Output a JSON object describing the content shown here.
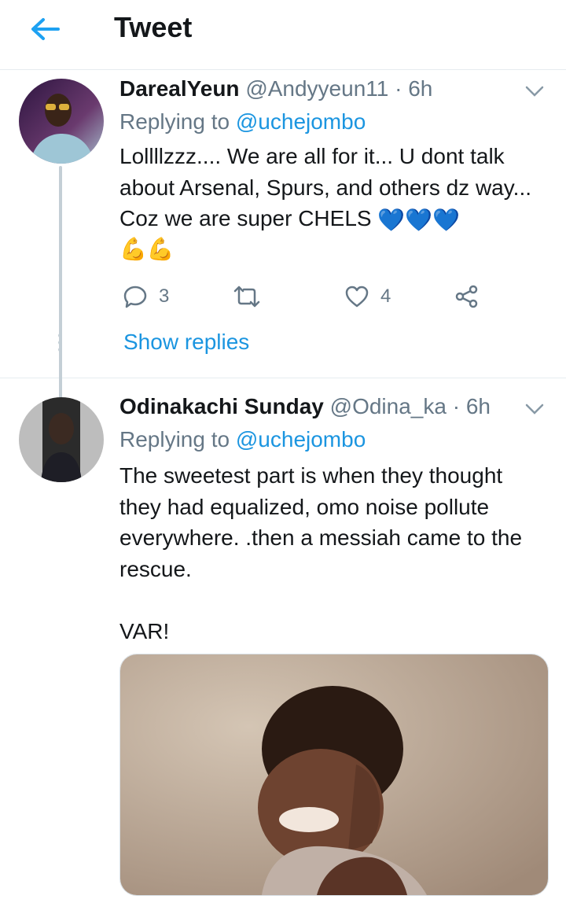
{
  "header": {
    "title": "Tweet"
  },
  "tweets": [
    {
      "display_name": "DarealYeun",
      "handle": "@Andyyeun11",
      "time": "· 6h",
      "replying_prefix": "Replying to",
      "replying_to": "@uchejombo",
      "text": "Lollllzzz.... We are all for it... U dont talk about Arsenal, Spurs, and others dz way... Coz we are super CHELS",
      "emoji_hearts": "💙💙💙",
      "emoji_flex": "💪💪",
      "reply_count": "3",
      "retweet_count": "",
      "like_count": "4",
      "show_replies": "Show replies"
    },
    {
      "display_name": "Odinakachi Sunday",
      "handle": "@Odina_ka",
      "time": "· 6h",
      "replying_prefix": "Replying to",
      "replying_to": "@uchejombo",
      "text_lines": [
        "The sweetest part is when they thought",
        "they had equalized, omo noise pollute",
        "everywhere. .then a messiah came to the",
        "rescue."
      ],
      "text_footer": "VAR!"
    }
  ],
  "icons": {
    "back": "arrow-left-icon",
    "chevron": "chevron-down-icon",
    "reply": "reply-icon",
    "retweet": "retweet-icon",
    "like": "heart-icon",
    "share": "share-icon"
  },
  "colors": {
    "accent": "#1b95e0",
    "secondary_text": "#657786",
    "divider": "#e6ecf0"
  }
}
